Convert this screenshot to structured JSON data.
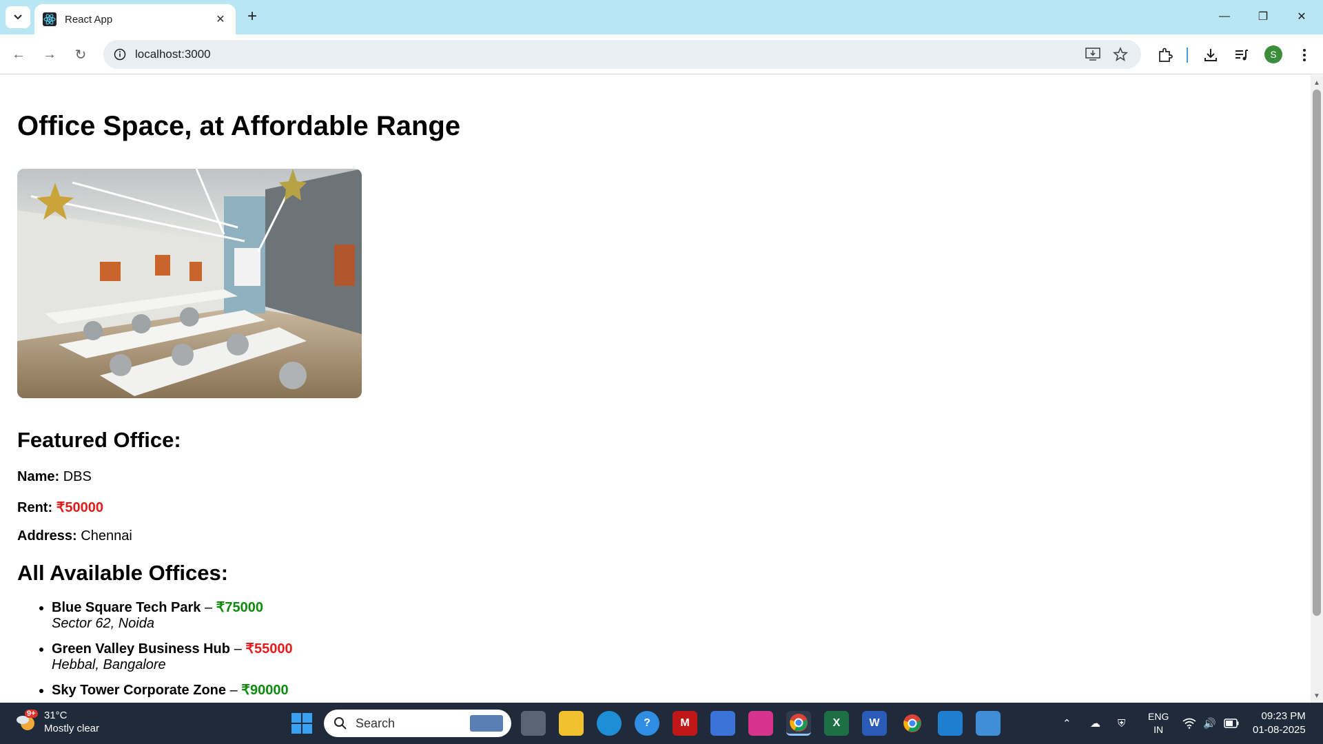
{
  "browser": {
    "tab_title": "React App",
    "url": "localhost:3000",
    "profile_initial": "S"
  },
  "page": {
    "heading": "Office Space, at Affordable Range",
    "featured": {
      "title": "Featured Office:",
      "name_label": "Name:",
      "name_value": "DBS",
      "rent_label": "Rent:",
      "rent_value": "₹50000",
      "address_label": "Address:",
      "address_value": "Chennai"
    },
    "all_title": "All Available Offices:",
    "offices": [
      {
        "name": "Blue Square Tech Park",
        "sep": "–",
        "rent": "₹75000",
        "rent_color": "#0e8a0e",
        "address": "Sector 62, Noida"
      },
      {
        "name": "Green Valley Business Hub",
        "sep": "–",
        "rent": "₹55000",
        "rent_color": "#e31b1b",
        "address": "Hebbal, Bangalore"
      },
      {
        "name": "Sky Tower Corporate Zone",
        "sep": "–",
        "rent": "₹90000",
        "rent_color": "#0e8a0e",
        "address": ""
      }
    ]
  },
  "taskbar": {
    "weather_temp": "31°C",
    "weather_desc": "Mostly clear",
    "weather_badge": "9+",
    "search_label": "Search",
    "lang_top": "ENG",
    "lang_bottom": "IN",
    "time": "09:23 PM",
    "date": "01-08-2025"
  },
  "colors": {
    "tabstrip": "#b8e6f2",
    "rent_red": "#e31b1b",
    "rent_green": "#0e8a0e",
    "taskbar": "#1f2a3a"
  }
}
